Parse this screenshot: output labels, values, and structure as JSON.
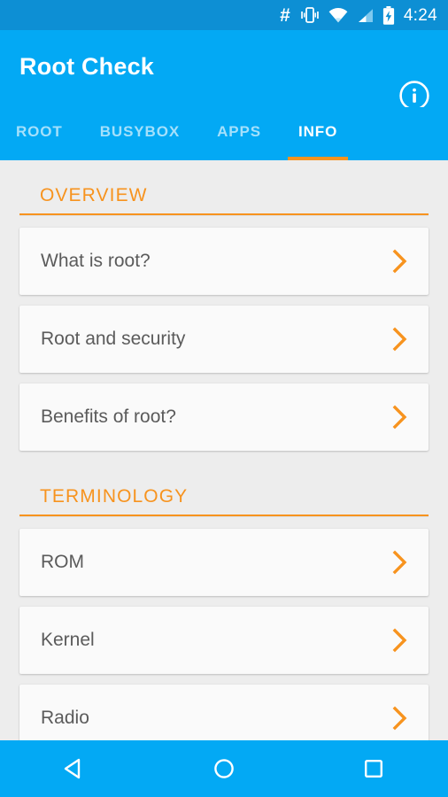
{
  "statusbar": {
    "icons": [
      "hash-icon",
      "vibrate-icon",
      "wifi-icon",
      "cellular-signal-icon",
      "battery-charging-icon"
    ],
    "time": "4:24",
    "background_color": "#0d8fd4"
  },
  "appbar": {
    "title": "Root Check",
    "info_icon": "info-icon",
    "background_color": "#03a9f4"
  },
  "tabs": [
    {
      "label": "ROOT",
      "active": false
    },
    {
      "label": "BUSYBOX",
      "active": false
    },
    {
      "label": "APPS",
      "active": false
    },
    {
      "label": "INFO",
      "active": true
    }
  ],
  "accent_color": "#f7931e",
  "sections": [
    {
      "title": "OVERVIEW",
      "items": [
        {
          "label": "What is root?",
          "chevron": "chevron-right-icon"
        },
        {
          "label": "Root and security",
          "chevron": "chevron-right-icon"
        },
        {
          "label": "Benefits of root?",
          "chevron": "chevron-right-icon"
        }
      ]
    },
    {
      "title": "TERMINOLOGY",
      "items": [
        {
          "label": "ROM",
          "chevron": "chevron-right-icon"
        },
        {
          "label": "Kernel",
          "chevron": "chevron-right-icon"
        },
        {
          "label": "Radio",
          "chevron": "chevron-right-icon"
        }
      ]
    }
  ],
  "navbar": {
    "back": "back-triangle-icon",
    "home": "home-circle-icon",
    "recents": "recents-square-icon",
    "background_color": "#03a9f4"
  }
}
